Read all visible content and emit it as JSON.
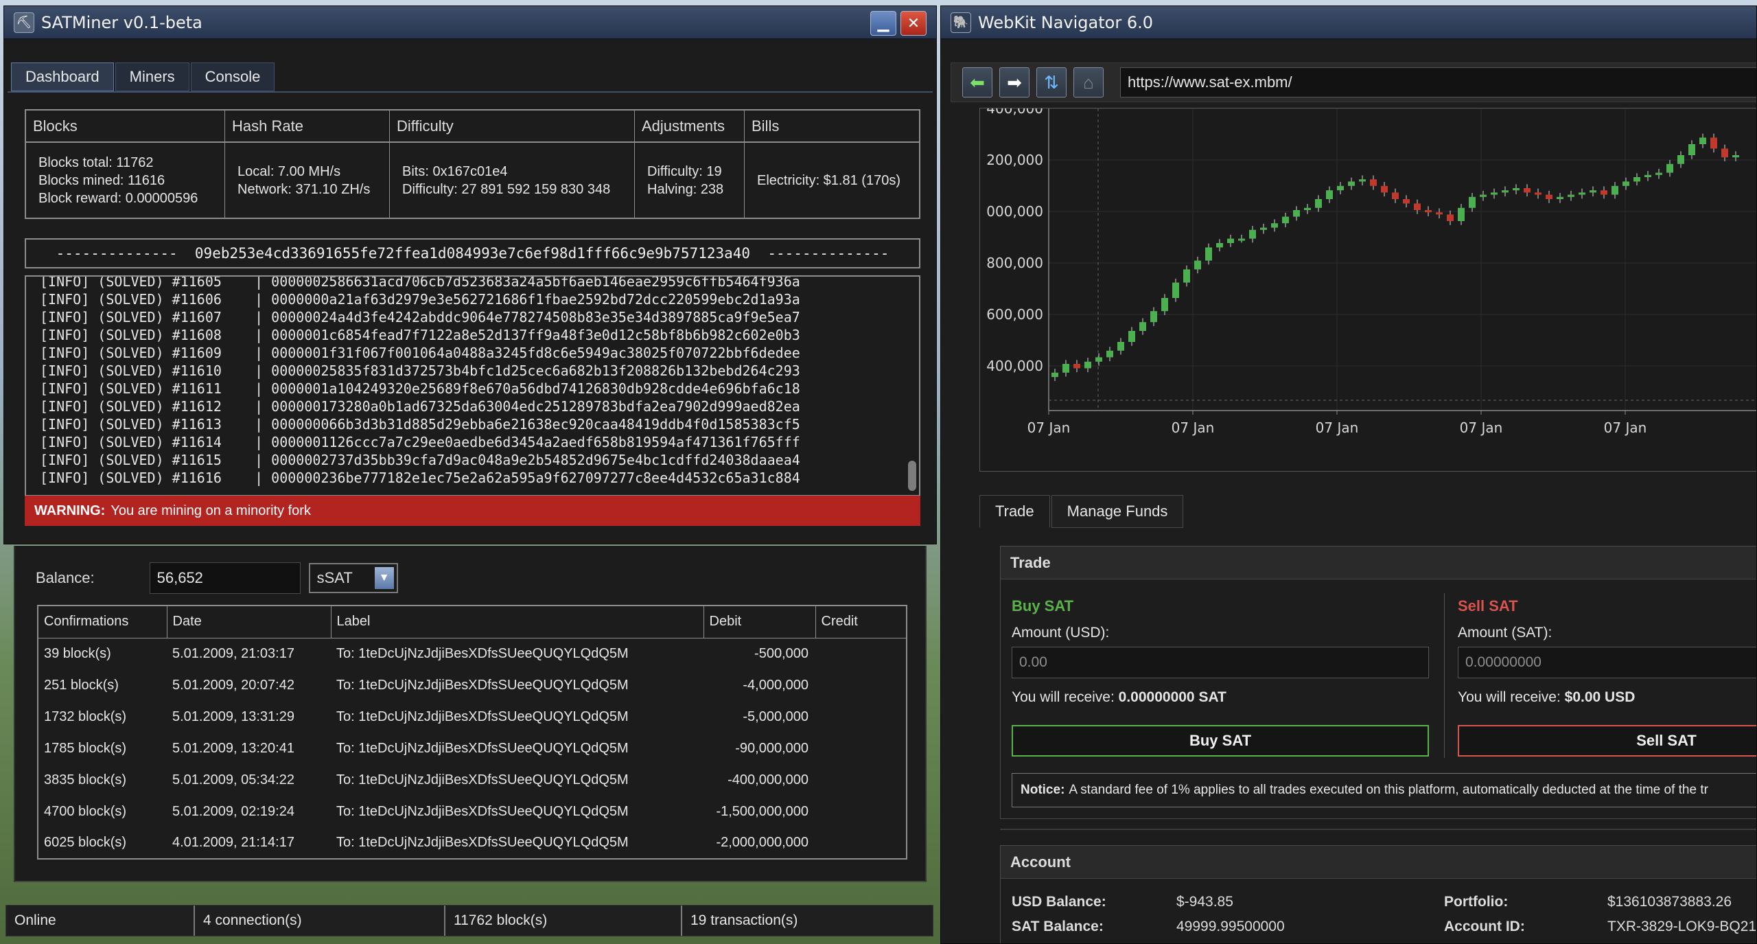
{
  "miner": {
    "title": "SATMiner v0.1-beta",
    "tabs": [
      "Dashboard",
      "Miners",
      "Console"
    ],
    "stats": {
      "headers": [
        "Blocks",
        "Hash Rate",
        "Difficulty",
        "Adjustments",
        "Bills"
      ],
      "blocks": [
        "Blocks total: 11762",
        "Blocks mined: 11616",
        "Block reward: 0.00000596"
      ],
      "hashrate": [
        "Local: 7.00 MH/s",
        "Network: 371.10 ZH/s"
      ],
      "difficulty": [
        "Bits: 0x167c01e4",
        "Difficulty: 27 891 592 159 830 348"
      ],
      "adjustments": [
        "Difficulty: 19",
        "Halving: 238"
      ],
      "bills": [
        "Electricity: $1.81 (170s)"
      ]
    },
    "current_hash": "--------------  09eb253e4cd33691655fe72ffea1d084993e7c6ef98d1fff66c9e9b757123a40  --------------",
    "log": [
      "[INFO] (SOLVED) #11605    | 0000002586631acd706cb7d523683a24a5bf6aeb146eae2959c6ffb5464f936a",
      "[INFO] (SOLVED) #11606    | 0000000a21af63d2979e3e562721686f1fbae2592bd72dcc220599ebc2d1a93a",
      "[INFO] (SOLVED) #11607    | 00000024a4d3fe4242abddc9064e778274508b83e35e34d3897885ca9f9e5ea7",
      "[INFO] (SOLVED) #11608    | 0000001c6854fead7f7122a8e52d137ff9a48f3e0d12c58bf8b6b982c602e0b3",
      "[INFO] (SOLVED) #11609    | 0000001f31f067f001064a0488a3245fd8c6e5949ac38025f070722bbf6dedee",
      "[INFO] (SOLVED) #11610    | 00000025835f831d372573b4bfc1d25cec6a682b13f208826b132bebd264c293",
      "[INFO] (SOLVED) #11611    | 0000001a104249320e25689f8e670a56dbd74126830db928cdde4e696bfa6c18",
      "[INFO] (SOLVED) #11612    | 000000173280a0b1ad67325da63004edc251289783bdfa2ea7902d999aed82ea",
      "[INFO] (SOLVED) #11613    | 000000066b3d3b31d885d29ebba6e21638ec920caa48419ddb4f0d1585383cf5",
      "[INFO] (SOLVED) #11614    | 0000001126ccc7a7c29ee0aedbe6d3454a2aedf658b819594af471361f765fff",
      "[INFO] (SOLVED) #11615    | 0000002737d35bb39cfa7d9ac048a9e2b54852d9675e4bc1cdffd24038daaea4",
      "[INFO] (SOLVED) #11616    | 000000236be777182e1ec75e2a62a595a9f627097277c8ee4d4532c65a31c884"
    ],
    "warning_label": "WARNING:",
    "warning_text": "You are mining on a minority fork"
  },
  "wallet": {
    "balance_label": "Balance:",
    "balance_value": "56,652",
    "unit": "sSAT",
    "columns": [
      "Confirmations",
      "Date",
      "Label",
      "Debit",
      "Credit"
    ],
    "rows": [
      {
        "conf": "39 block(s)",
        "date": "5.01.2009, 21:03:17",
        "label": "To: 1teDcUjNzJdjiBesXDfsSUeeQUQYLQdQ5M",
        "debit": "-500,000",
        "credit": ""
      },
      {
        "conf": "251 block(s)",
        "date": "5.01.2009, 20:07:42",
        "label": "To: 1teDcUjNzJdjiBesXDfsSUeeQUQYLQdQ5M",
        "debit": "-4,000,000",
        "credit": ""
      },
      {
        "conf": "1732 block(s)",
        "date": "5.01.2009, 13:31:29",
        "label": "To: 1teDcUjNzJdjiBesXDfsSUeeQUQYLQdQ5M",
        "debit": "-5,000,000",
        "credit": ""
      },
      {
        "conf": "1785 block(s)",
        "date": "5.01.2009, 13:20:41",
        "label": "To: 1teDcUjNzJdjiBesXDfsSUeeQUQYLQdQ5M",
        "debit": "-90,000,000",
        "credit": ""
      },
      {
        "conf": "3835 block(s)",
        "date": "5.01.2009, 05:34:22",
        "label": "To: 1teDcUjNzJdjiBesXDfsSUeeQUQYLQdQ5M",
        "debit": "-400,000,000",
        "credit": ""
      },
      {
        "conf": "4700 block(s)",
        "date": "5.01.2009, 02:19:24",
        "label": "To: 1teDcUjNzJdjiBesXDfsSUeeQUQYLQdQ5M",
        "debit": "-1,500,000,000",
        "credit": ""
      },
      {
        "conf": "6025 block(s)",
        "date": "4.01.2009, 21:14:17",
        "label": "To: 1teDcUjNzJdjiBesXDfsSUeeQUQYLQdQ5M",
        "debit": "-2,000,000,000",
        "credit": ""
      }
    ]
  },
  "status": {
    "state": "Online",
    "connections": "4 connection(s)",
    "blocks": "11762 block(s)",
    "transactions": "19 transaction(s)"
  },
  "browser": {
    "title": "WebKit Navigator 6.0",
    "url": "https://www.sat-ex.mbm/",
    "tabs": [
      "Trade",
      "Manage Funds"
    ],
    "trade": {
      "header": "Trade",
      "buy_title": "Buy SAT",
      "buy_amount_label": "Amount (USD):",
      "buy_placeholder": "0.00",
      "buy_receive_label": "You will receive:",
      "buy_receive_value": "0.00000000 SAT",
      "buy_button": "Buy SAT",
      "sell_title": "Sell SAT",
      "sell_amount_label": "Amount (SAT):",
      "sell_placeholder": "0.00000000",
      "sell_receive_label": "You will receive:",
      "sell_receive_value": "$0.00 USD",
      "sell_button": "Sell SAT",
      "notice_label": "Notice:",
      "notice_text": "A standard fee of 1% applies to all trades executed on this platform, automatically deducted at the time of the tr"
    },
    "account": {
      "header": "Account",
      "usd_label": "USD Balance:",
      "usd_value": "$-943.85",
      "sat_label": "SAT Balance:",
      "sat_value": "49999.99500000",
      "portfolio_label": "Portfolio:",
      "portfolio_value": "$136103873883.26",
      "id_label": "Account ID:",
      "id_value": "TXR-3829-LOK9-BQ21"
    }
  },
  "colors": {
    "warning": "#b3231f",
    "buy": "#5ab34a",
    "sell": "#d9534f",
    "candle_up": "#4caf50",
    "candle_down": "#c0392b"
  },
  "chart_data": {
    "type": "candlestick",
    "y_tick_labels": [
      "400,000",
      "200,000",
      "000,000",
      "800,000",
      "600,000",
      "400,000"
    ],
    "x_tick_labels": [
      "07 Jan",
      "07 Jan",
      "07 Jan",
      "07 Jan",
      "07 Jan"
    ],
    "series": [
      {
        "values": [
          110,
          150,
          130,
          160,
          180,
          210,
          250,
          300,
          340,
          390,
          450,
          520,
          580,
          620,
          680,
          700,
          720,
          720,
          760,
          770,
          790,
          820,
          850,
          860,
          900,
          940,
          960,
          980,
          990,
          960,
          930,
          900,
          880,
          850,
          840,
          830,
          800,
          860,
          910,
          920,
          930,
          940,
          950,
          930,
          920,
          900,
          910,
          920,
          930,
          940,
          920,
          960,
          980,
          1000,
          1010,
          1020,
          1060,
          1100,
          1150,
          1180,
          1130,
          1090,
          1100
        ]
      }
    ]
  }
}
